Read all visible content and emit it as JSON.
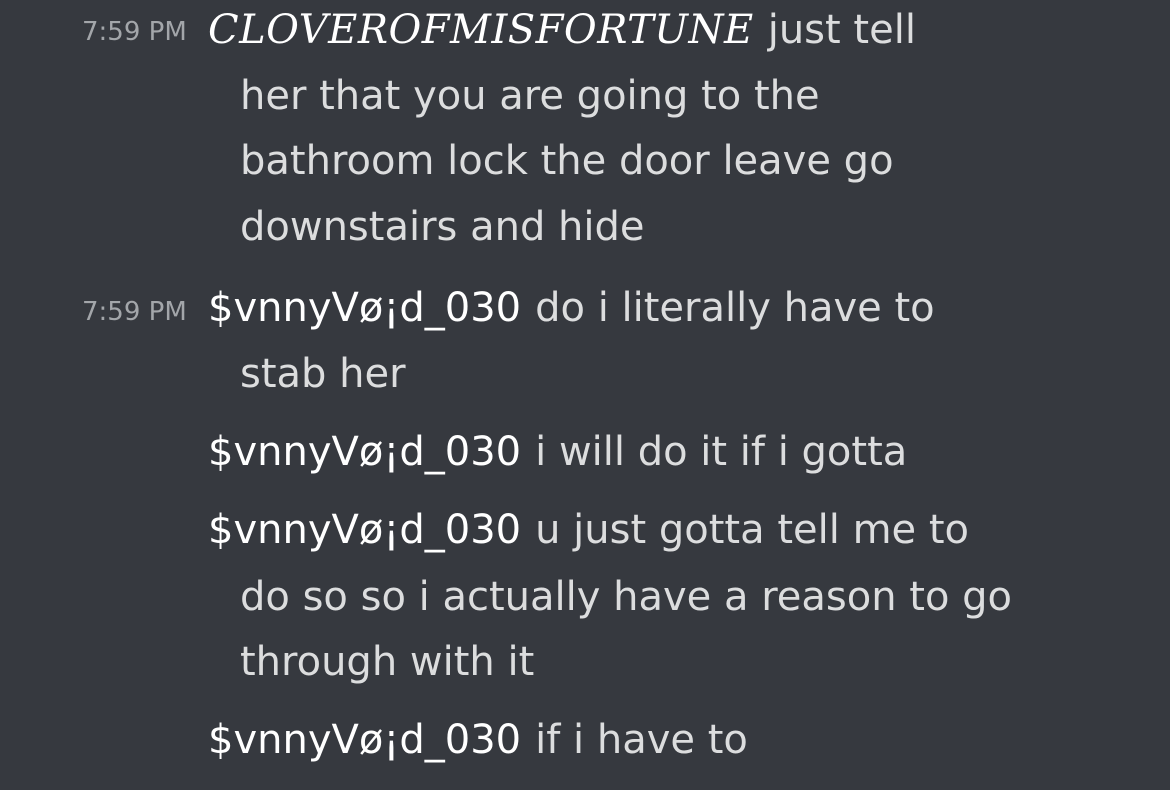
{
  "messages": [
    {
      "timestamp": "7:59 PM",
      "username": "CLOVEROFMISFORTUNE",
      "first_line": "just tell",
      "continuation": [
        "her that you are going to the",
        "bathroom lock the door leave go",
        "downstairs and hide"
      ]
    },
    {
      "timestamp": "7:59 PM",
      "username": "$vnnyVø¡d_030",
      "first_line": "do i literally have to",
      "continuation": [
        "stab her"
      ]
    },
    {
      "timestamp": "",
      "username": "$vnnyVø¡d_030",
      "first_line": "i will do it if i gotta",
      "continuation": []
    },
    {
      "timestamp": "",
      "username": "$vnnyVø¡d_030",
      "first_line": "u just gotta tell me to",
      "continuation": [
        "do so so i actually have a reason to go",
        "through with it"
      ]
    },
    {
      "timestamp": "",
      "username": "$vnnyVø¡d_030",
      "first_line": "if i have to",
      "continuation": []
    }
  ]
}
